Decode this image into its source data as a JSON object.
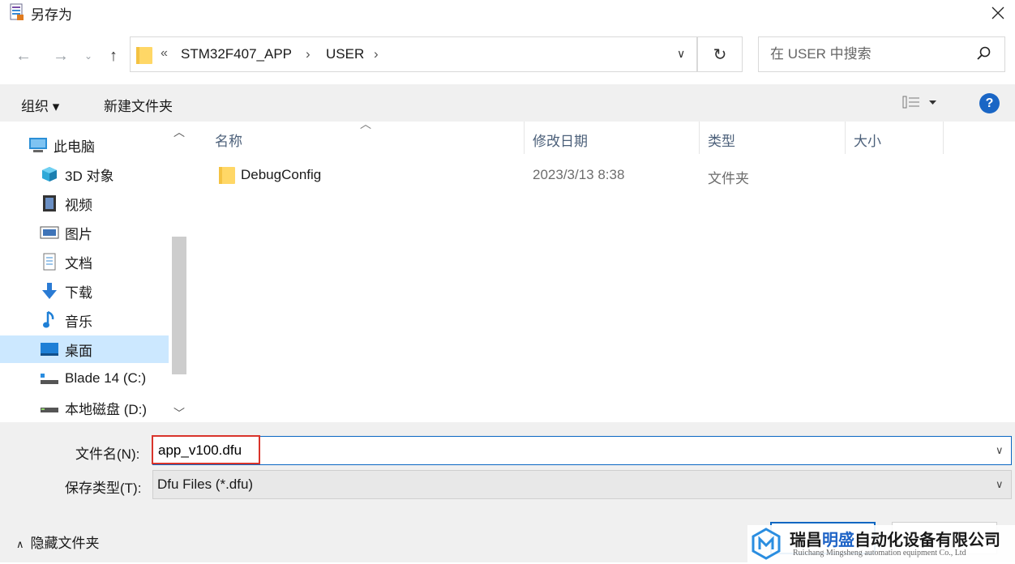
{
  "window": {
    "title": "另存为"
  },
  "nav": {
    "breadcrumb_overflow": "«",
    "breadcrumbs": [
      "STM32F407_APP",
      "USER"
    ],
    "search_placeholder": "在 USER 中搜索"
  },
  "toolbar": {
    "organize": "组织 ▾",
    "new_folder": "新建文件夹",
    "help": "?"
  },
  "sidebar": {
    "items": [
      {
        "label": "此电脑",
        "icon": "pc-icon"
      },
      {
        "label": "3D 对象",
        "icon": "cube-3d-icon"
      },
      {
        "label": "视频",
        "icon": "video-icon"
      },
      {
        "label": "图片",
        "icon": "picture-icon"
      },
      {
        "label": "文档",
        "icon": "document-icon"
      },
      {
        "label": "下载",
        "icon": "download-icon"
      },
      {
        "label": "音乐",
        "icon": "music-icon"
      },
      {
        "label": "桌面",
        "icon": "desktop-icon"
      },
      {
        "label": "Blade 14 (C:)",
        "icon": "drive-c-icon"
      },
      {
        "label": "本地磁盘 (D:)",
        "icon": "drive-icon"
      }
    ],
    "selected": "桌面"
  },
  "file_list": {
    "columns": [
      "名称",
      "修改日期",
      "类型",
      "大小"
    ],
    "rows": [
      {
        "name": "DebugConfig",
        "modified": "2023/3/13 8:38",
        "type": "文件夹",
        "size": ""
      }
    ]
  },
  "form": {
    "filename_label": "文件名(N):",
    "filename_value": "app_v100.dfu",
    "filetype_label": "保存类型(T):",
    "filetype_value": "Dfu Files (*.dfu)"
  },
  "footer": {
    "hide_folders": "隐藏文件夹"
  },
  "watermark": {
    "company_a": "瑞昌",
    "company_b": "明盛",
    "company_c": "自动化设备有限公司",
    "company_en": "Ruichang Mingsheng automation equipment Co., Ltd"
  },
  "colors": {
    "accent": "#0a66c2",
    "highlight": "#d9342b",
    "selected_bg": "#cce8ff",
    "brand_blue": "#1e63c6"
  }
}
